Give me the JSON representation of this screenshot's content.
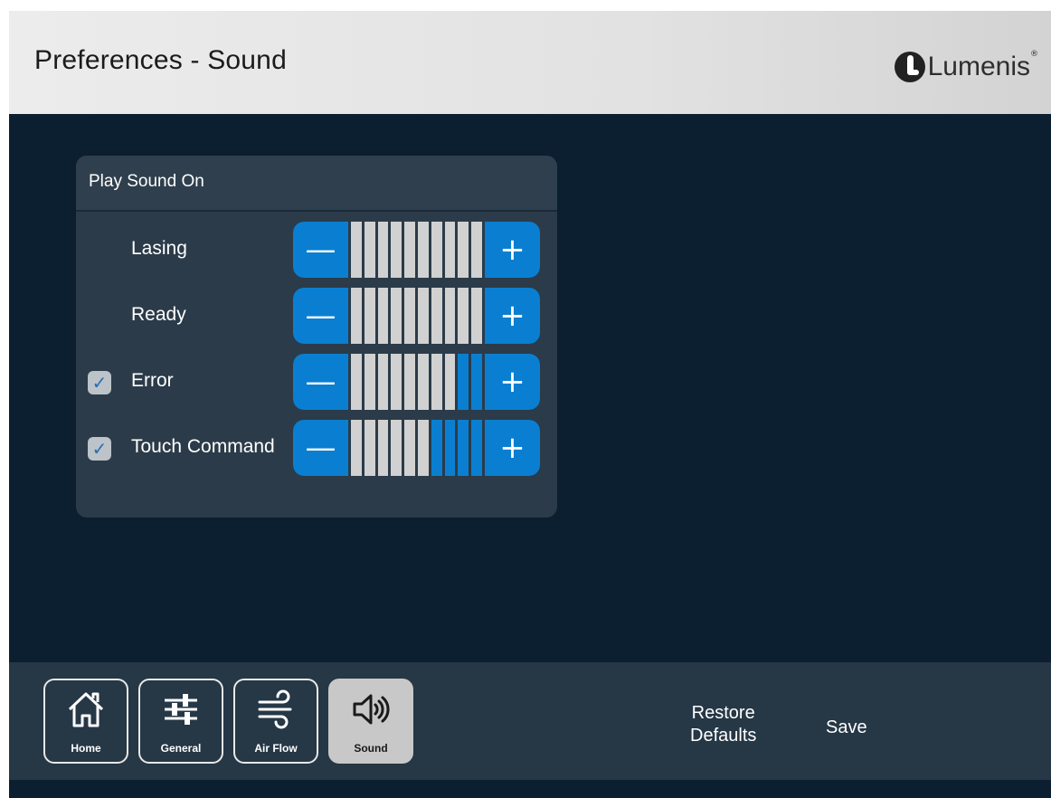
{
  "header": {
    "title": "Preferences - Sound",
    "logo_text": "Lumenis",
    "logo_mark": "®"
  },
  "panel": {
    "title": "Play Sound On",
    "rows": [
      {
        "label": "Lasing",
        "checkbox": false,
        "volume_filled": 0,
        "volume_segments": 10
      },
      {
        "label": "Ready",
        "checkbox": false,
        "volume_filled": 0,
        "volume_segments": 10
      },
      {
        "label": "Error",
        "checkbox": true,
        "checked": true,
        "volume_filled": 2,
        "volume_segments": 10
      },
      {
        "label": "Touch Command",
        "checkbox": true,
        "checked": true,
        "volume_filled": 4,
        "volume_segments": 10
      }
    ],
    "minus_symbol": "—",
    "plus_symbol": "+",
    "check_symbol": "✓"
  },
  "footer": {
    "nav": [
      {
        "label": "Home",
        "icon": "home-icon",
        "active": false
      },
      {
        "label": "General",
        "icon": "sliders-icon",
        "active": false
      },
      {
        "label": "Air Flow",
        "icon": "wind-icon",
        "active": false
      },
      {
        "label": "Sound",
        "icon": "speaker-icon",
        "active": true
      }
    ],
    "restore_line1": "Restore",
    "restore_line2": "Defaults",
    "save_label": "Save"
  },
  "colors": {
    "background": "#0b1f30",
    "panel": "#2b3b49",
    "accent_blue": "#0a7fd1",
    "segment_off": "#d1d1d1",
    "footer": "#263746"
  }
}
